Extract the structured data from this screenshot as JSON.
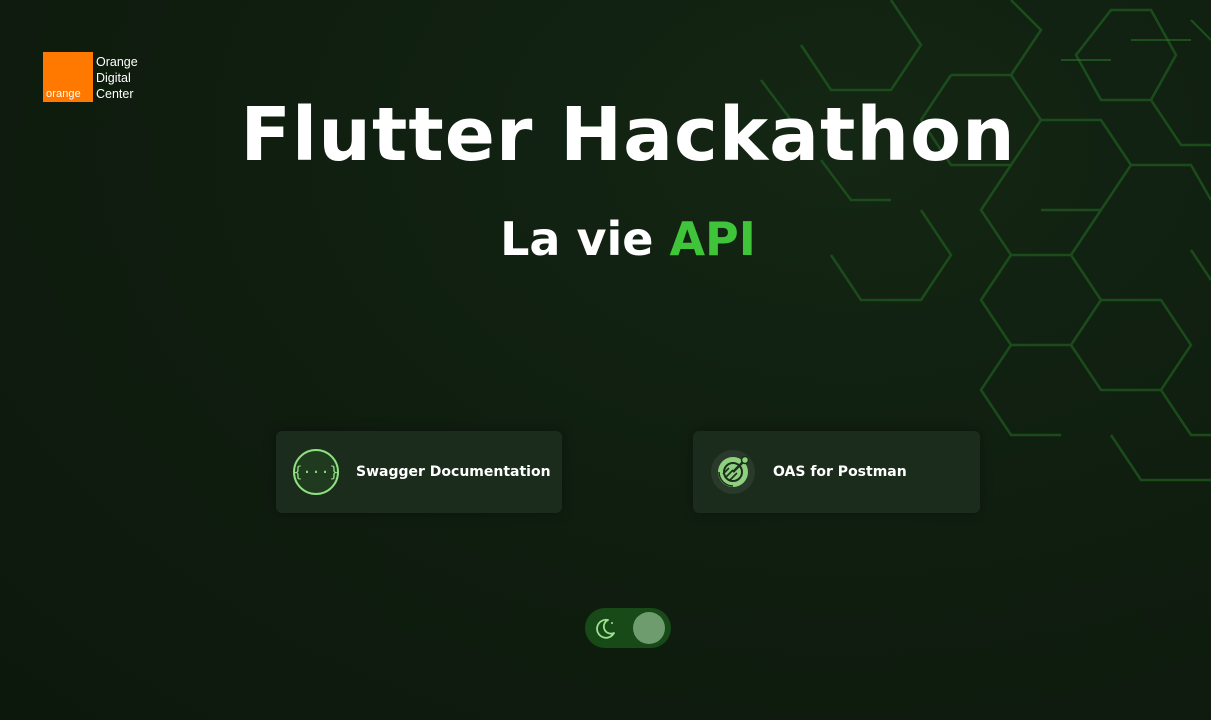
{
  "brand": {
    "logo_word": "orange",
    "logo_suffix": "™",
    "name_lines": [
      "Orange",
      "Digital",
      "Center"
    ],
    "color": "#ff7900"
  },
  "hero": {
    "title": "Flutter Hackathon",
    "subtitle_prefix": "La vie",
    "subtitle_accent": "API",
    "accent_color": "#3fc43a"
  },
  "links": [
    {
      "label": "Swagger Documentation",
      "icon": "swagger-icon"
    },
    {
      "label": "OAS for Postman",
      "icon": "postman-icon"
    }
  ],
  "theme_toggle": {
    "icon": "moon-icon",
    "state": "dark"
  }
}
